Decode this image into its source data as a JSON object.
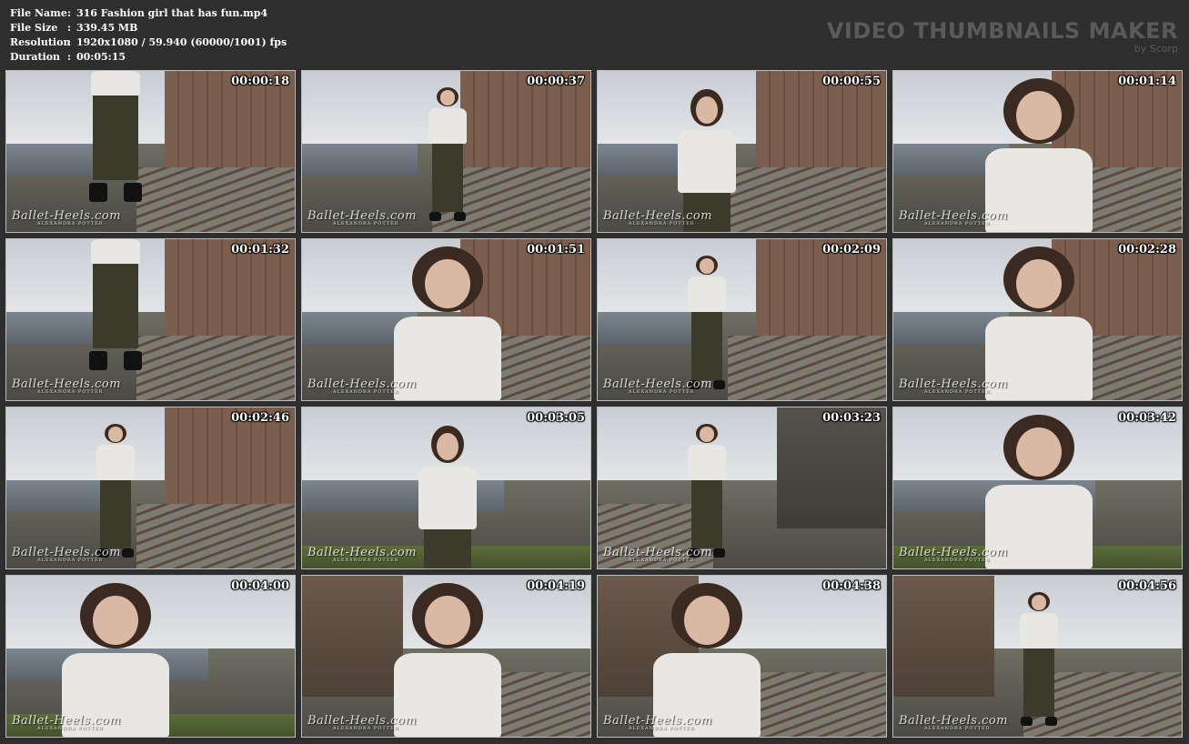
{
  "file_info": [
    {
      "key": "File Name",
      "value": "316 Fashion girl that has fun.mp4"
    },
    {
      "key": "File Size",
      "value": "339.45 MB"
    },
    {
      "key": "Resolution",
      "value": "1920x1080 / 59.940 (60000/1001) fps"
    },
    {
      "key": "Duration",
      "value": "00:05:15"
    }
  ],
  "separator": ":",
  "brand": {
    "title": "VIDEO THUMBNAILS MAKER",
    "subtitle": "by Scorp"
  },
  "watermark": {
    "main": "Ballet-Heels.com",
    "sub": "ALEXANDRA POTTER"
  },
  "thumbnails": [
    {
      "time": "00:00:18",
      "scene": "tracks",
      "shot": "legs"
    },
    {
      "time": "00:00:37",
      "scene": "tracks",
      "shot": "full"
    },
    {
      "time": "00:00:55",
      "scene": "tracks",
      "shot": "mid"
    },
    {
      "time": "00:01:14",
      "scene": "tracks",
      "shot": "close"
    },
    {
      "time": "00:01:32",
      "scene": "tracks",
      "shot": "legs"
    },
    {
      "time": "00:01:51",
      "scene": "tracks",
      "shot": "close"
    },
    {
      "time": "00:02:09",
      "scene": "tracks",
      "shot": "full"
    },
    {
      "time": "00:02:28",
      "scene": "tracks",
      "shot": "close"
    },
    {
      "time": "00:02:46",
      "scene": "tracks",
      "shot": "full"
    },
    {
      "time": "00:03:05",
      "scene": "river",
      "shot": "mid"
    },
    {
      "time": "00:03:23",
      "scene": "wall",
      "shot": "full"
    },
    {
      "time": "00:03:42",
      "scene": "river",
      "shot": "close"
    },
    {
      "time": "00:04:00",
      "scene": "river",
      "shot": "close"
    },
    {
      "time": "00:04:19",
      "scene": "yard",
      "shot": "close"
    },
    {
      "time": "00:04:38",
      "scene": "yard",
      "shot": "close"
    },
    {
      "time": "00:04:56",
      "scene": "yard",
      "shot": "full"
    }
  ]
}
